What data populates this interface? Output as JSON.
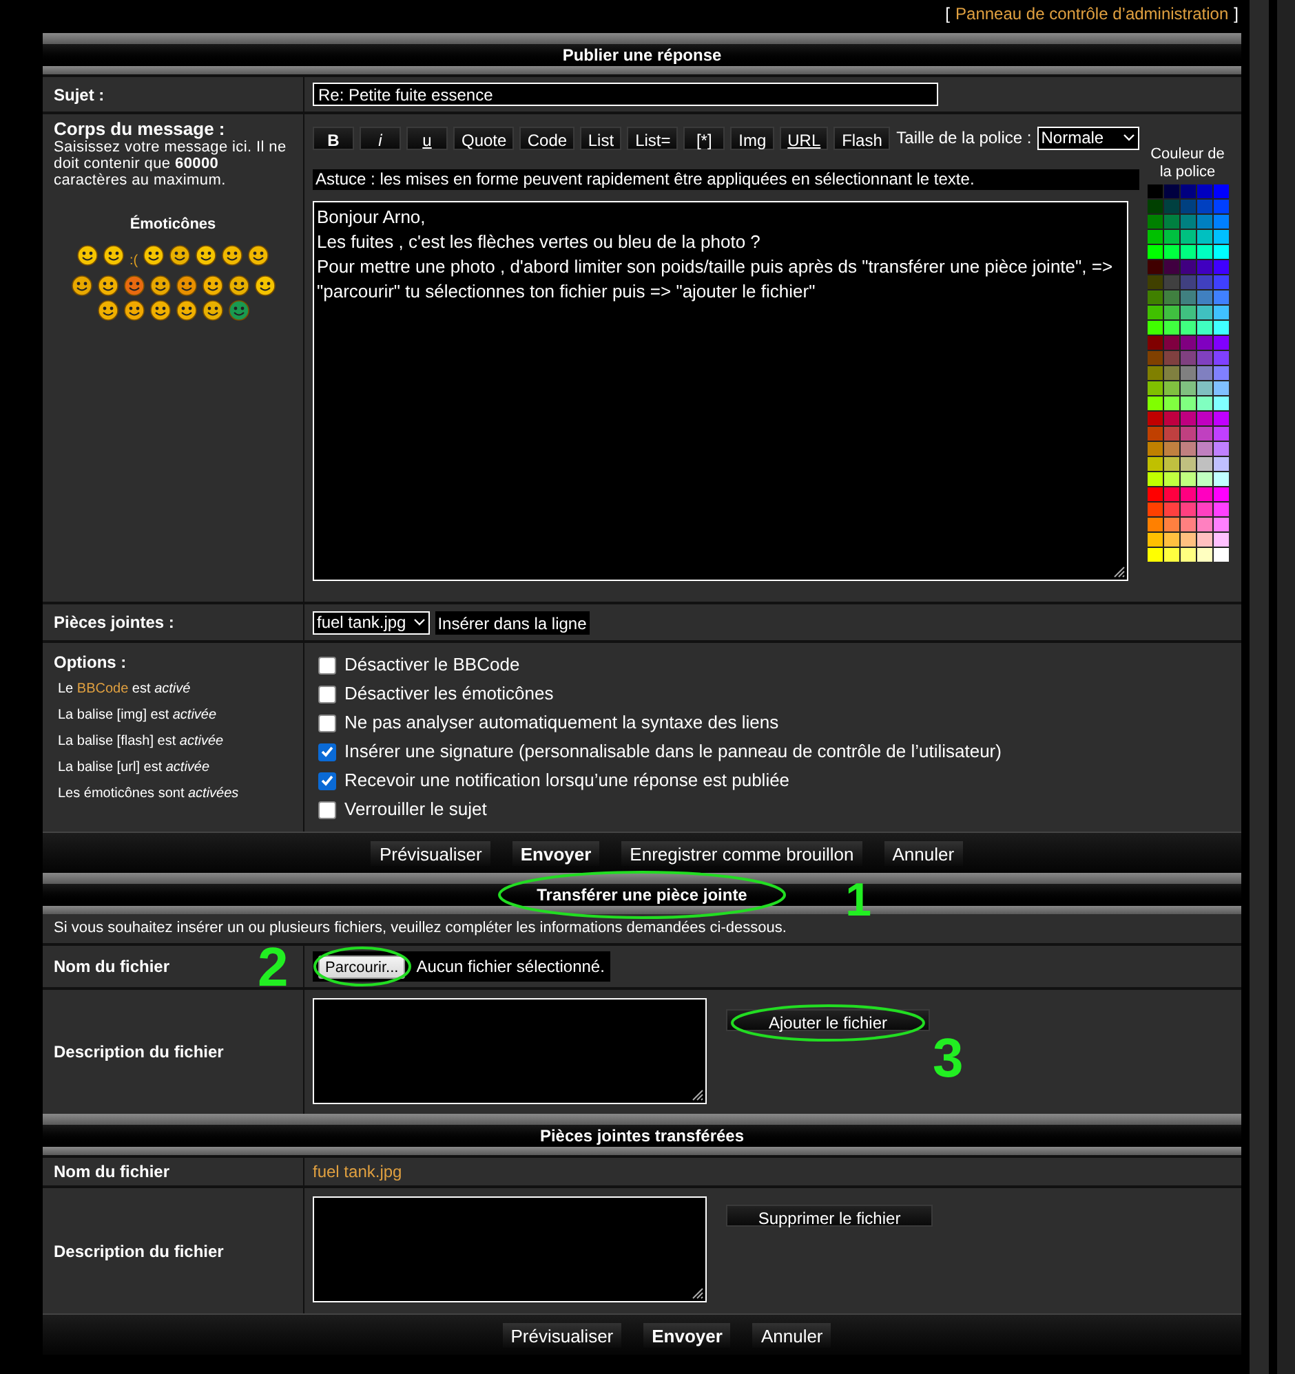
{
  "admin_link": {
    "open": "[",
    "label": "Panneau de contrôle d’administration",
    "close": "]"
  },
  "post_form": {
    "title": "Publier une réponse",
    "subject": {
      "label": "Sujet :",
      "value": "Re: Petite fuite essence"
    },
    "body": {
      "label": "Corps du message :",
      "hint": "Saisissez votre message ici. Il ne doit contenir que **60000** caractères au maximum.",
      "emoticons_title": "Émoticônes",
      "emoticons": [
        {
          "kind": "face",
          "color": "#f5c400"
        },
        {
          "kind": "face",
          "color": "#f5c400"
        },
        {
          "kind": "text",
          "text": ":("
        },
        {
          "kind": "face",
          "color": "#f5c400"
        },
        {
          "kind": "face",
          "color": "#e8b000"
        },
        {
          "kind": "face",
          "color": "#f5c400"
        },
        {
          "kind": "face",
          "color": "#f0b800"
        },
        {
          "kind": "face",
          "color": "#f0b800"
        },
        {
          "kind": "face",
          "color": "#e8a800"
        },
        {
          "kind": "face",
          "color": "#f0b000"
        },
        {
          "kind": "face",
          "color": "#e86a10"
        },
        {
          "kind": "face",
          "color": "#e8a800"
        },
        {
          "kind": "face",
          "color": "#e89000"
        },
        {
          "kind": "face",
          "color": "#f0b000"
        },
        {
          "kind": "face",
          "color": "#e8b000"
        },
        {
          "kind": "face",
          "color": "#f5c400"
        },
        {
          "kind": "face",
          "color": "#f0b000"
        },
        {
          "kind": "face",
          "color": "#f0a800"
        },
        {
          "kind": "face",
          "color": "#f0b000"
        },
        {
          "kind": "face",
          "color": "#f0b000"
        },
        {
          "kind": "face",
          "color": "#e8b000"
        },
        {
          "kind": "face",
          "color": "#1a9a50"
        }
      ],
      "toolbar": [
        {
          "label": "B",
          "kind": "bold"
        },
        {
          "label": "i",
          "kind": "italic"
        },
        {
          "label": "u",
          "kind": "underline"
        },
        {
          "label": "Quote",
          "kind": "plain"
        },
        {
          "label": "Code",
          "kind": "plain"
        },
        {
          "label": "List",
          "kind": "plain"
        },
        {
          "label": "List=",
          "kind": "plain"
        },
        {
          "label": "[*]",
          "kind": "plain"
        },
        {
          "label": "Img",
          "kind": "plain"
        },
        {
          "label": "URL",
          "kind": "underline"
        },
        {
          "label": "Flash",
          "kind": "plain"
        }
      ],
      "font_size": {
        "label": "Taille de la police :",
        "value": "Normale"
      },
      "tip": "Astuce : les mises en forme peuvent rapidement être appliquées en sélectionnant le texte.",
      "color_title": "Couleur de la police",
      "message_lines": [
        "Bonjour Arno,",
        "Les fuites , c'est les flèches vertes ou bleu de la photo ?",
        "Pour mettre une photo , d'abord limiter son poids/taille puis après ds \"transférer une pièce jointe\", => \"parcourir\" tu sélectionnes ton fichier puis => \"ajouter le fichier\""
      ]
    },
    "attachments": {
      "label": "Pièces jointes :",
      "file": "fuel tank.jpg",
      "insert_button": "Insérer dans la ligne"
    },
    "options": {
      "label": "Options :",
      "statuses": [
        {
          "parts": [
            {
              "kind": "plain",
              "text": "Le "
            },
            {
              "kind": "link",
              "text": "BBCode"
            },
            {
              "kind": "plain",
              "text": " est "
            },
            {
              "kind": "italic",
              "text": "activé"
            }
          ]
        },
        {
          "parts": [
            {
              "kind": "plain",
              "text": "La balise [img] est "
            },
            {
              "kind": "italic",
              "text": "activée"
            }
          ]
        },
        {
          "parts": [
            {
              "kind": "plain",
              "text": "La balise [flash] est "
            },
            {
              "kind": "italic",
              "text": "activée"
            }
          ]
        },
        {
          "parts": [
            {
              "kind": "plain",
              "text": "La balise [url] est "
            },
            {
              "kind": "italic",
              "text": "activée"
            }
          ]
        },
        {
          "parts": [
            {
              "kind": "plain",
              "text": "Les émoticônes sont "
            },
            {
              "kind": "italic",
              "text": "activées"
            }
          ]
        }
      ],
      "checkboxes": [
        {
          "label": "Désactiver le BBCode",
          "checked": false
        },
        {
          "label": "Désactiver les émoticônes",
          "checked": false
        },
        {
          "label": "Ne pas analyser automatiquement la syntaxe des liens",
          "checked": false
        },
        {
          "label": "Insérer une signature (personnalisable dans le panneau de contrôle de l’utilisateur)",
          "checked": true
        },
        {
          "label": "Recevoir une notification lorsqu’une réponse est publiée",
          "checked": true
        },
        {
          "label": "Verrouiller le sujet",
          "checked": false
        }
      ]
    },
    "buttons": [
      {
        "label": "Prévisualiser",
        "primary": false
      },
      {
        "label": "Envoyer",
        "primary": true
      },
      {
        "label": "Enregistrer comme brouillon",
        "primary": false
      },
      {
        "label": "Annuler",
        "primary": false
      }
    ]
  },
  "upload": {
    "title": "Transférer une pièce jointe",
    "intro": "Si vous souhaitez insérer un ou plusieurs fichiers, veuillez compléter les informations demandées ci-dessous.",
    "filename_label": "Nom du fichier",
    "browse_button": "Parcourir...",
    "no_file": "Aucun fichier sélectionné.",
    "description_label": "Description du fichier",
    "add_button": "Ajouter le fichier"
  },
  "uploaded": {
    "title": "Pièces jointes transférées",
    "filename_label": "Nom du fichier",
    "file": "fuel tank.jpg",
    "description_label": "Description du fichier",
    "delete_button": "Supprimer le fichier"
  },
  "bottom_buttons": [
    {
      "label": "Prévisualiser",
      "primary": false
    },
    {
      "label": "Envoyer",
      "primary": true
    },
    {
      "label": "Annuler",
      "primary": false
    }
  ],
  "annotations": [
    {
      "number": "1"
    },
    {
      "number": "2"
    },
    {
      "number": "3"
    }
  ]
}
